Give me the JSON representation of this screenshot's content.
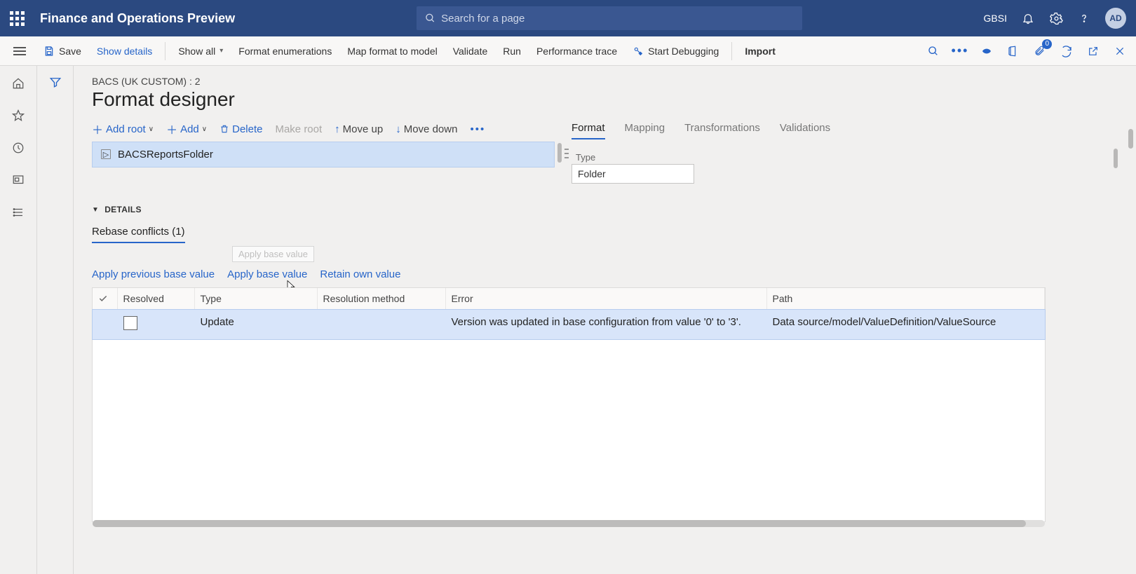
{
  "header": {
    "app_title": "Finance and Operations Preview",
    "search_placeholder": "Search for a page",
    "company": "GBSI",
    "avatar_initials": "AD"
  },
  "cmdbar": {
    "save": "Save",
    "show_details": "Show details",
    "show_all": "Show all",
    "format_enum": "Format enumerations",
    "map_format": "Map format to model",
    "validate": "Validate",
    "run": "Run",
    "perf_trace": "Performance trace",
    "start_debug": "Start Debugging",
    "import": "Import",
    "badge_count": "0"
  },
  "page": {
    "breadcrumb": "BACS (UK CUSTOM) : 2",
    "title": "Format designer"
  },
  "tree_toolbar": {
    "add_root": "Add root",
    "add": "Add",
    "delete": "Delete",
    "make_root": "Make root",
    "move_up": "Move up",
    "move_down": "Move down"
  },
  "tree": {
    "root_node": "BACSReportsFolder"
  },
  "tabs": {
    "format": "Format",
    "mapping": "Mapping",
    "transformations": "Transformations",
    "validations": "Validations"
  },
  "props": {
    "type_label": "Type",
    "type_value": "Folder"
  },
  "details": {
    "header": "DETAILS",
    "tab_label": "Rebase conflicts (1)",
    "actions": {
      "apply_prev": "Apply previous base value",
      "apply_base": "Apply base value",
      "retain_own": "Retain own value",
      "tooltip": "Apply base value"
    },
    "cols": {
      "resolved": "Resolved",
      "type": "Type",
      "method": "Resolution method",
      "error": "Error",
      "path": "Path"
    },
    "rows": [
      {
        "resolved": false,
        "type": "Update",
        "method": "",
        "error": "Version was updated in base configuration from value '0' to '3'.",
        "path": "Data source/model/ValueDefinition/ValueSource"
      }
    ]
  }
}
